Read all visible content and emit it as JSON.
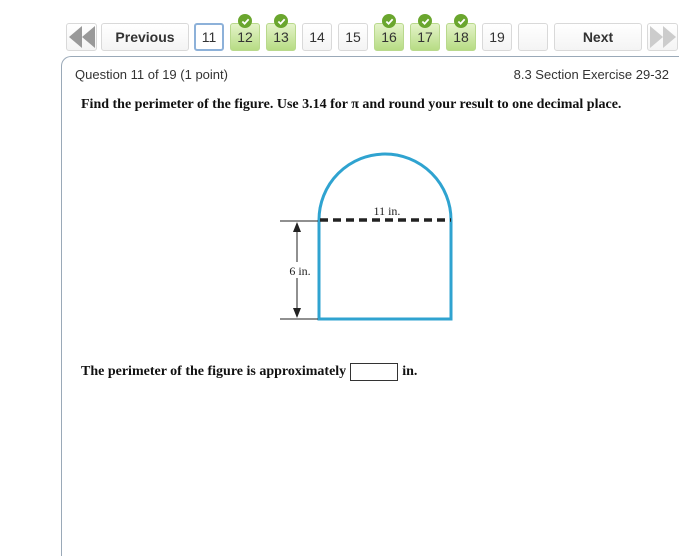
{
  "nav": {
    "first_icon": "double-left-arrow-icon",
    "previous_label": "Previous",
    "next_label": "Next",
    "last_icon": "double-right-arrow-icon",
    "questions": [
      {
        "label": "11",
        "state": "current"
      },
      {
        "label": "12",
        "state": "completed"
      },
      {
        "label": "13",
        "state": "completed"
      },
      {
        "label": "14",
        "state": "unanswered"
      },
      {
        "label": "15",
        "state": "unanswered"
      },
      {
        "label": "16",
        "state": "completed"
      },
      {
        "label": "17",
        "state": "completed"
      },
      {
        "label": "18",
        "state": "completed"
      },
      {
        "label": "19",
        "state": "unanswered"
      },
      {
        "label": "",
        "state": "unanswered"
      }
    ]
  },
  "question": {
    "header": "Question 11 of 19 (1 point)",
    "section": "8.3 Section Exercise 29-32",
    "prompt": "Find the perimeter of the figure. Use 3.14 for π and round your result to one decimal place.",
    "figure": {
      "width_label": "11 in.",
      "height_label": "6 in.",
      "shape_color": "#2fa3d0"
    },
    "answer_prefix": "The perimeter of the figure is approximately",
    "answer_value": "",
    "answer_suffix": "in."
  }
}
